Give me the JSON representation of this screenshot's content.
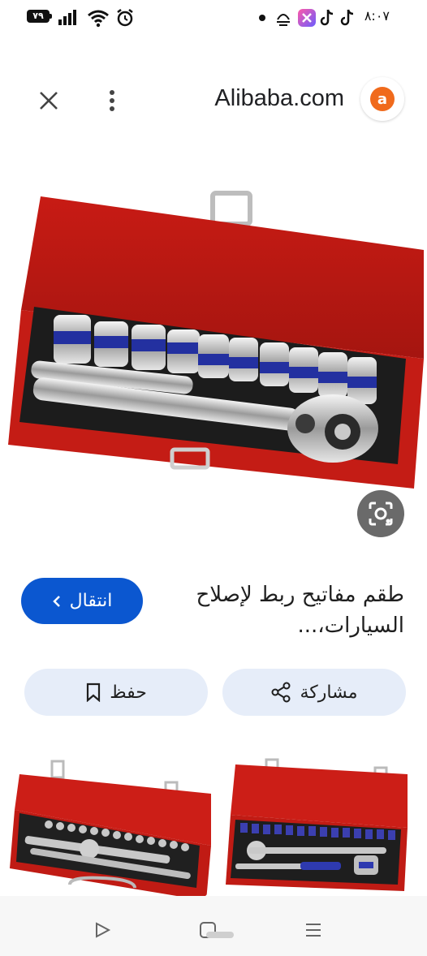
{
  "status_bar": {
    "battery": "٧٩",
    "time": "٨:٠٧"
  },
  "header": {
    "site_name": "Alibaba.com",
    "logo_letter": "a"
  },
  "product": {
    "title": "طقم مفاتيح ربط لإصلاح السيارات،...",
    "brand_color": "#f06a1c",
    "case_color": "#d1211b"
  },
  "actions": {
    "visit_label": "انتقال",
    "share_label": "مشاركة",
    "save_label": "حفظ"
  },
  "nav_bar": {
    "icons": [
      "back-triangle-icon",
      "home-square-icon",
      "recents-lines-icon"
    ]
  }
}
